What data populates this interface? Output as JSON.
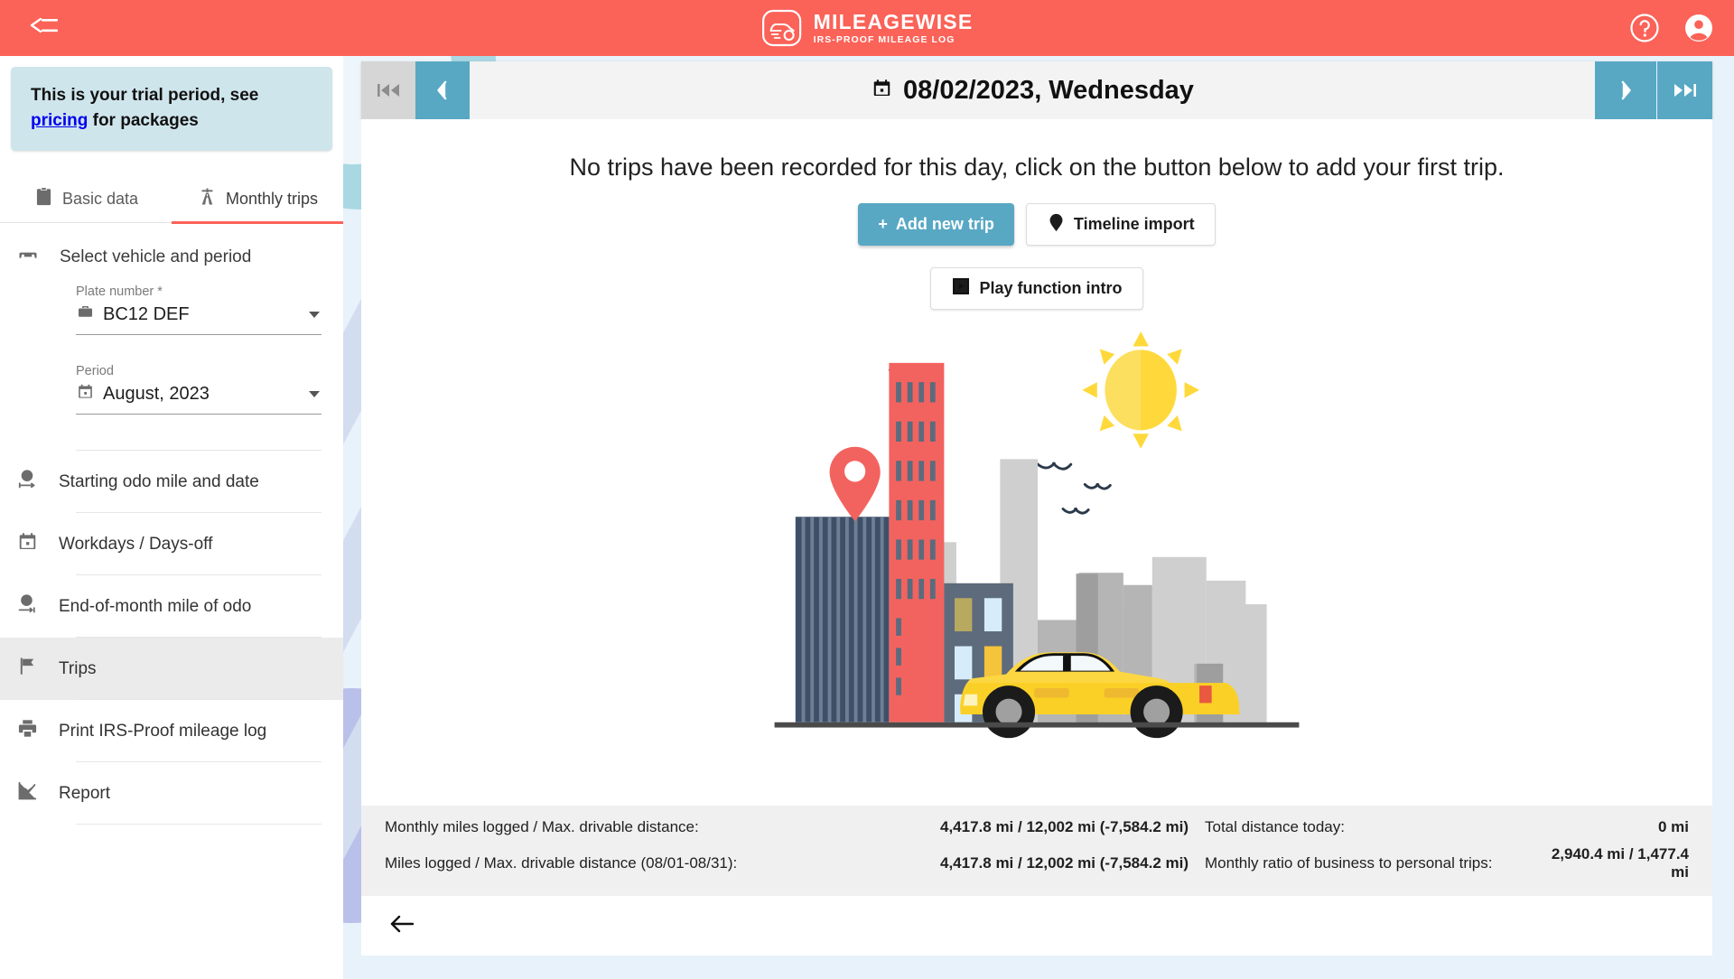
{
  "header": {
    "brand_name": "MILEAGEWISE",
    "brand_sub": "IRS-PROOF MILEAGE LOG",
    "menu_icon": "collapse-menu-icon",
    "help_icon": "help-circle-icon",
    "account_icon": "account-circle-icon",
    "accent_color": "#fb6258"
  },
  "sidebar": {
    "trial": {
      "text_before": "This is your trial period, see ",
      "link": "pricing",
      "text_after": " for packages"
    },
    "tabs": [
      {
        "label": "Basic data",
        "icon": "clipboard-icon",
        "active": false
      },
      {
        "label": "Monthly trips",
        "icon": "highway-icon",
        "active": true
      }
    ],
    "section_title": "Select vehicle and period",
    "section_icon": "car-icon",
    "fields": [
      {
        "label": "Plate number *",
        "value": "BC12 DEF",
        "icon": "briefcase-icon"
      },
      {
        "label": "Period",
        "value": "August, 2023",
        "icon": "calendar-icon"
      }
    ],
    "nav_items": [
      {
        "label": "Starting odo mile and date",
        "icon": "clock-start-icon",
        "active": false
      },
      {
        "label": "Workdays / Days-off",
        "icon": "calendar-icon",
        "active": false
      },
      {
        "label": "End-of-month mile of odo",
        "icon": "clock-end-icon",
        "active": false
      },
      {
        "label": "Trips",
        "icon": "flag-icon",
        "active": true
      },
      {
        "label": "Print IRS-Proof mileage log",
        "icon": "printer-icon",
        "active": false
      },
      {
        "label": "Report",
        "icon": "chart-line-icon",
        "active": false
      }
    ]
  },
  "main": {
    "datebar": {
      "first_icon": "skip-to-first-icon",
      "prev_icon": "chevron-left-icon",
      "next_icon": "chevron-right-icon",
      "last_icon": "skip-to-last-icon",
      "calendar_icon": "calendar-icon",
      "date": "08/02/2023, Wednesday"
    },
    "empty_message": "No trips have been recorded for this day, click on the button below to add your first trip.",
    "buttons": {
      "add_trip": "Add new trip",
      "add_trip_icon": "plus-icon",
      "timeline_import": "Timeline import",
      "timeline_import_icon": "map-pin-icon",
      "play_intro": "Play function intro",
      "play_intro_icon": "play-box-icon"
    },
    "illustration": "city-skyline-with-car-illustration",
    "summary": {
      "row1_label": "Monthly miles logged / Max. drivable distance:",
      "row1_value": "4,417.8 mi / 12,002 mi (-7,584.2 mi)",
      "row1_label2": "Total distance today:",
      "row1_value2": "0 mi",
      "row2_label": "Miles logged / Max. drivable distance (08/01-08/31):",
      "row2_value": "4,417.8 mi / 12,002 mi (-7,584.2 mi)",
      "row2_label2": "Monthly ratio of business to personal trips:",
      "row2_value2": "2,940.4 mi / 1,477.4 mi"
    },
    "back_icon": "arrow-left-icon"
  }
}
